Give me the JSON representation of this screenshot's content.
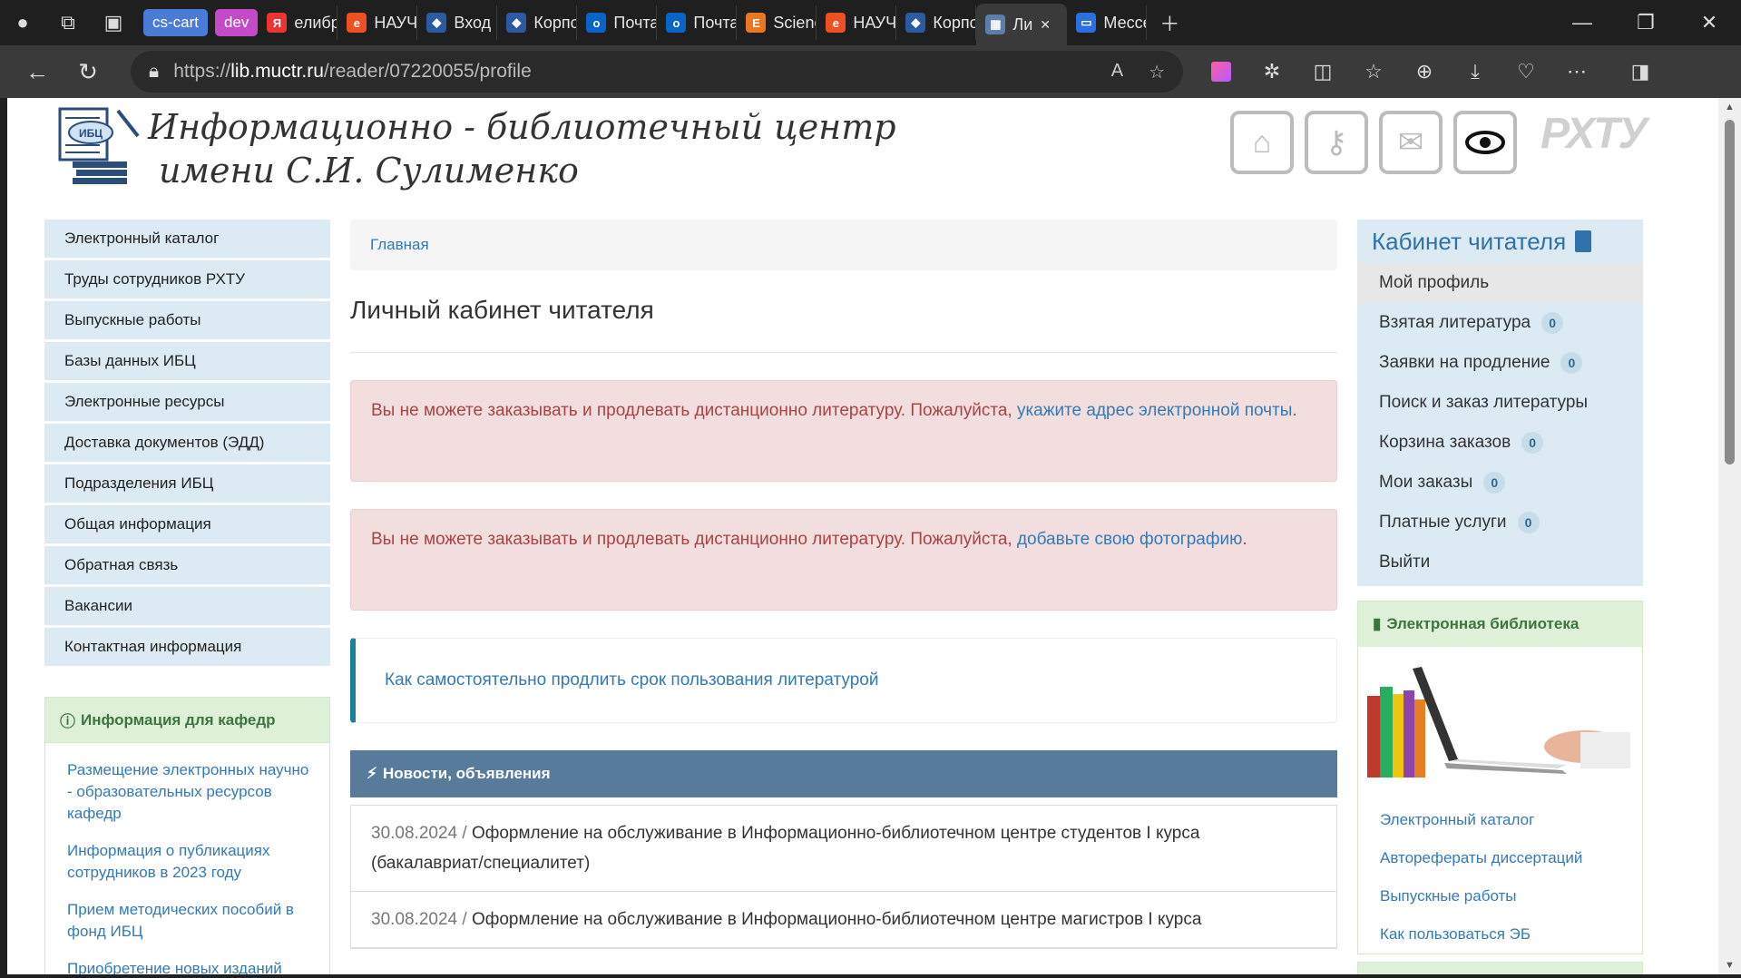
{
  "browser": {
    "tabs": [
      {
        "label": "cs-cart",
        "kind": "pill",
        "color": "#4a7bd6"
      },
      {
        "label": "dev",
        "kind": "pill",
        "color": "#c54ac8"
      },
      {
        "label": "елибра",
        "favicon": "Я",
        "favcolor": "#e33"
      },
      {
        "label": "НАУЧН",
        "favicon": "e",
        "favcolor": "#f04e23"
      },
      {
        "label": "Вход в",
        "favicon": "◆",
        "favcolor": "#2c5aa0"
      },
      {
        "label": "Корпор",
        "favicon": "◆",
        "favcolor": "#2c5aa0"
      },
      {
        "label": "Почта -",
        "favicon": "o",
        "favcolor": "#0a64c8"
      },
      {
        "label": "Почта -",
        "favicon": "o",
        "favcolor": "#0a64c8"
      },
      {
        "label": "Science",
        "favicon": "E",
        "favcolor": "#e87722"
      },
      {
        "label": "НАУЧН",
        "favicon": "e",
        "favcolor": "#f04e23"
      },
      {
        "label": "Корпор",
        "favicon": "◆",
        "favcolor": "#2c5aa0"
      },
      {
        "label": "Ли",
        "favicon": "▦",
        "favcolor": "#5b7fa8",
        "active": true
      },
      {
        "label": "Мессен",
        "favicon": "▭",
        "favcolor": "#2a6fe0"
      }
    ],
    "url_scheme": "https://",
    "url_host": "lib.muctr.ru",
    "url_path": "/reader/07220055/profile"
  },
  "header": {
    "logo_line1": "Информационно - библиотечный центр",
    "logo_line2": "имени С.И. Сулименко",
    "logo_badge": "ИБЦ",
    "brand_mark": "РХТУ"
  },
  "left_nav": {
    "items": [
      "Электронный каталог",
      "Труды сотрудников РХТУ",
      "Выпускные работы",
      "Базы данных ИБЦ",
      "Электронные ресурсы",
      "Доставка документов (ЭДД)",
      "Подразделения ИБЦ",
      "Общая информация",
      "Обратная связь",
      "Вакансии",
      "Контактная информация"
    ]
  },
  "dept_panel": {
    "title": "Информация для кафедр",
    "links": [
      "Размещение электронных научно - образовательных ресурсов кафедр",
      "Информация о публикациях сотрудников в 2023 году",
      "Прием методических пособий в фонд ИБЦ",
      "Приобретение новых изданий"
    ]
  },
  "main": {
    "breadcrumb": "Главная",
    "title": "Личный кабинет читателя",
    "alert1_text": "Вы не можете заказывать и продлевать дистанционно литературу. Пожалуйста, ",
    "alert1_link": "укажите адрес электронной почты",
    "alert2_text": "Вы не можете заказывать и продлевать дистанционно литературу. Пожалуйста, ",
    "alert2_link": "добавьте свою фотографию",
    "callout_link": "Как самостоятельно продлить срок пользования литературой",
    "news_title": "Новости, объявления",
    "news": [
      {
        "date": "30.08.2024",
        "text": "Оформление на обслуживание в Информационно-библиотечном центре студентов I курса (бакалавриат/специалитет)"
      },
      {
        "date": "30.08.2024",
        "text": "Оформление на обслуживание в Информационно-библиотечном центре магистров I курса"
      }
    ]
  },
  "cabinet": {
    "title": "Кабинет читателя",
    "items": [
      {
        "label": "Мой профиль",
        "active": true
      },
      {
        "label": "Взятая литература",
        "badge": "0"
      },
      {
        "label": "Заявки на продление",
        "badge": "0"
      },
      {
        "label": "Поиск и заказ литературы"
      },
      {
        "label": "Корзина заказов",
        "badge": "0"
      },
      {
        "label": "Мои заказы",
        "badge": "0"
      },
      {
        "label": "Платные услуги",
        "badge": "0"
      },
      {
        "label": "Выйти"
      }
    ]
  },
  "elib": {
    "title": "Электронная библиотека",
    "links": [
      "Электронный каталог",
      "Авторефераты диссертаций",
      "Выпускные работы",
      "Как пользоваться ЭБ"
    ]
  }
}
